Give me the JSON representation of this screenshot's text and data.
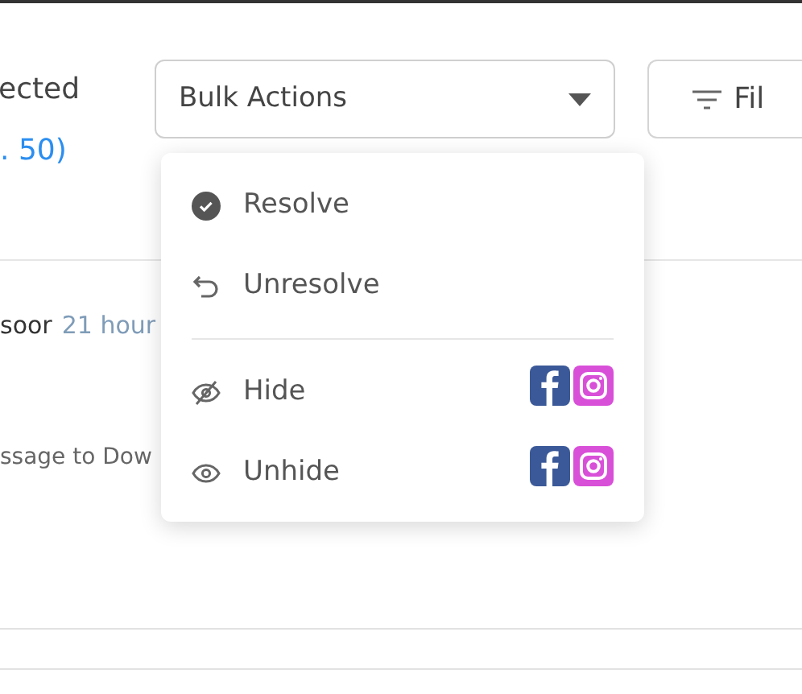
{
  "header": {
    "selected_text": "ected",
    "count_link": ". 50)",
    "bulk_button": {
      "label": "Bulk Actions",
      "expanded": true
    },
    "filter_button": {
      "label": "Fil"
    }
  },
  "message": {
    "author": "soor",
    "time": "21 hour",
    "preview": "ssage to Dow"
  },
  "bulk_menu": {
    "groups": [
      [
        {
          "kind": "resolve",
          "label": "Resolve"
        },
        {
          "kind": "unresolve",
          "label": "Unresolve"
        }
      ],
      [
        {
          "kind": "hide",
          "label": "Hide",
          "badges": [
            {
              "kind": "facebook"
            },
            {
              "kind": "instagram"
            }
          ]
        },
        {
          "kind": "unhide",
          "label": "Unhide",
          "badges": [
            {
              "kind": "facebook"
            },
            {
              "kind": "instagram"
            }
          ]
        }
      ]
    ]
  }
}
